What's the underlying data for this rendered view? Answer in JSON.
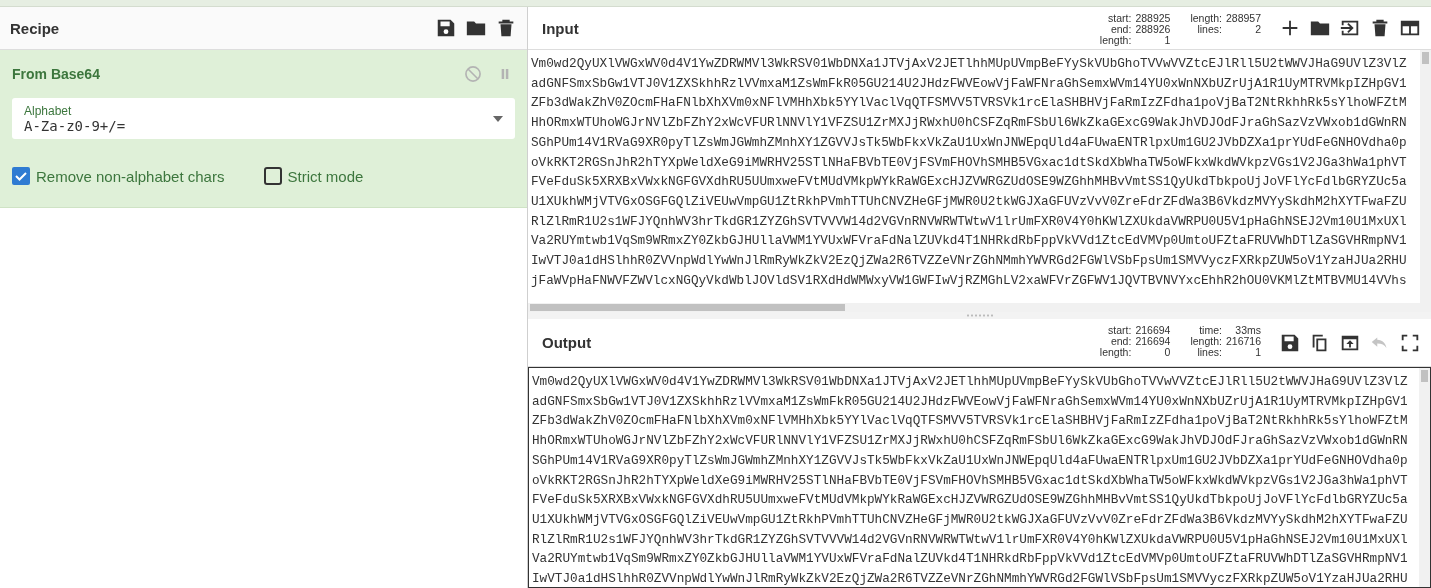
{
  "recipe": {
    "title": "Recipe",
    "operations": [
      {
        "name": "From Base64",
        "fields": [
          {
            "kind": "dropdown",
            "label": "Alphabet",
            "value": "A-Za-z0-9+/="
          }
        ],
        "checkboxes": [
          {
            "label": "Remove non-alphabet chars",
            "checked": true
          },
          {
            "label": "Strict mode",
            "checked": false
          }
        ]
      }
    ]
  },
  "input": {
    "title": "Input",
    "stats": [
      [
        {
          "label": "start:",
          "value": "288925"
        },
        {
          "label": "end:",
          "value": "288926"
        },
        {
          "label": "length:",
          "value": "1"
        }
      ],
      [
        {
          "label": "length:",
          "value": "288957"
        },
        {
          "label": "lines:",
          "value": "2"
        }
      ]
    ],
    "lines": [
      "Vm0wd2QyUXlVWGxWV0d4V1YwZDRWMVl3WkRSV01WbDNXa1JTVjAxV2JETlhhMUpUVmpBeFYySkVUbGhoTVVwVVZtcEJlRll5U2tWWVJHaG9UVlZ3VlZ",
      "adGNFSmxSbGw1VTJ0V1ZXSkhhRzlVVmxaM1ZsWmFkR05GU214U2JHdzFWVEowVjFaWFNraGhSemxWVm14YU0xWnNXbUZrUjA1R1UyMTRVMkpIZHpGV1",
      "ZFb3dWakZhV0ZOcmFHaFNlbXhXVm0xNFlVMHhXbk5YYlVaclVqQTFSMVV5TVRSVk1rcElaSHBHVjFaRmIzZFdha1poVjBaT2NtRkhhRk5sYlhoWFZtM",
      "HhORmxWTUhoWGJrNVlZbFZhY2xWcVFURlNNVlY1VFZSU1ZrMXJjRWxhU0hCSFZqRmFSbUl6WkZkaGExcG9WakJhVDJOdFJraGhSazVzVWxob1dGWnRN",
      "SGhPUm14V1RVaG9XR0pyTlZsWmJGWmhZMnhXY1ZGVVJsTk5WbFkxVkZaU1UxWnJNWEpqUld4aFUwaENTRlpxUm1GU2JVbDZXa1prYUdFeGNHOVdha0p",
      "oVkRKT2RGSnJhR2hTYXpWeldXeG9iMWRHV25STlNHaFBVbTE0VjFSVmFHOVhSMHB5VGxac1dtSkdXbWhaTW5oWFkxWkdWVkpzVGs1V2JGa3hWa1phVT",
      "FVeFduSk5XRXBxVWxkNGFGVXdhRU5UUmxweFVtMUdVMkpWYkRaWGExcHJZVWRGZUdOSE9WZGhhMHBvVmtSS1QyUkdTbkpoUjJoVFlYcFdlbGRYZUc5a",
      "U1XUkhWMjVTVGxOSGFGQlZiVEUwVmpGU1ZtRkhPVmhTTUhCNVZHeGFjMWR0U2tkWGJXaGFUVzVvV0ZreFdrZFdWa3B6VkdzMVYySkdhM2hXYTFwaFZU",
      "RlZlRmR1U2s1WFJYQnhWV3hrTkdGR1ZYZGhSVTVVVW14d2VGVnRNVWRWTWtwV1lrUmFXR0V4Y0hKWlZXUkdaVWRPU0U5V1pHaGhNSEJ2Vm10U1MxUXl",
      "Va2RUYmtwb1VqSm9WRmxZY0ZkbGJHUllaVWM1YVUxWFVraFdNalZUVkd4T1NHRkdRbFppVkVVd1ZtcEdVMVp0UmtoUFZtaFRUVWhDTlZaSGVHRmpNV1",
      "IwVTJ0a1dHSlhhR0ZVVnpWdlYwWnJlRmRyWkZkV2EzQjZWa2R6TVZZeVNrZGhNMmhYWVRGd2FGWlVSbFpsUm1SMVVyczFXRkpZUW5oV1YzaHJUa2RHU",
      "jFaWVpHaFNWVFZWVlcxNGQyVkdWblJOVldSV1RXdHdWMWxyVW1GWFIwVjRZMGhLV2xaWFVrZGFWV1JQVTBVNVYxcEhhR2hOU0VKMlZtMTBVMU14VVhs"
    ]
  },
  "output": {
    "title": "Output",
    "stats": [
      [
        {
          "label": "start:",
          "value": "216694"
        },
        {
          "label": "end:",
          "value": "216694"
        },
        {
          "label": "length:",
          "value": "0"
        }
      ],
      [
        {
          "label": "time:",
          "value": "33ms"
        },
        {
          "label": "length:",
          "value": "216716"
        },
        {
          "label": "lines:",
          "value": "1"
        }
      ]
    ],
    "lines": [
      "Vm0wd2QyUXlVWGxWV0d4V1YwZDRWMVl3WkRSV01WbDNXa1JTVjAxV2JETlhhMUpUVmpBeFYySkVUbGhoTVVwVVZtcEJlRll5U2tWWVJHaG9UVlZ3VlZ",
      "adGNFSmxSbGw1VTJ0V1ZXSkhhRzlVVmxaM1ZsWmFkR05GU214U2JHdzFWVEowVjFaWFNraGhSemxWVm14YU0xWnNXbUZrUjA1R1UyMTRVMkpIZHpGV1",
      "ZFb3dWakZhV0ZOcmFHaFNlbXhXVm0xNFlVMHhXbk5YYlVaclVqQTFSMVV5TVRSVk1rcElaSHBHVjFaRmIzZFdha1poVjBaT2NtRkhhRk5sYlhoWFZtM",
      "HhORmxWTUhoWGJrNVlZbFZhY2xWcVFURlNNVlY1VFZSU1ZrMXJjRWxhU0hCSFZqRmFSbUl6WkZkaGExcG9WakJhVDJOdFJraGhSazVzVWxob1dGWnRN",
      "SGhPUm14V1RVaG9XR0pyTlZsWmJGWmhZMnhXY1ZGVVJsTk5WbFkxVkZaU1UxWnJNWEpqUld4aFUwaENTRlpxUm1GU2JVbDZXa1prYUdFeGNHOVdha0p",
      "oVkRKT2RGSnJhR2hTYXpWeldXeG9iMWRHV25STlNHaFBVbTE0VjFSVmFHOVhSMHB5VGxac1dtSkdXbWhaTW5oWFkxWkdWVkpzVGs1V2JGa3hWa1phVT",
      "FVeFduSk5XRXBxVWxkNGFGVXdhRU5UUmxweFVtMUdVMkpWYkRaWGExcHJZVWRGZUdOSE9WZGhhMHBvVmtSS1QyUkdTbkpoUjJoVFlYcFdlbGRYZUc5a",
      "U1XUkhWMjVTVGxOSGFGQlZiVEUwVmpGU1ZtRkhPVmhTTUhCNVZHeGFjMWR0U2tkWGJXaGFUVzVvV0ZreFdrZFdWa3B6VkdzMVYySkdhM2hXYTFwaFZU",
      "RlZlRmR1U2s1WFJYQnhWV3hrTkdGR1ZYZGhSVTVVVW14d2VGVnRNVWRWTWtwV1lrUmFXR0V4Y0hKWlZXUkdaVWRPU0U5V1pHaGhNSEJ2Vm10U1MxUXl",
      "Va2RUYmtwb1VqSm9WRmxZY0ZkbGJHUllaVWM1YVUxWFVraFdNalZUVkd4T1NHRkdRbFppVkVVd1ZtcEdVMVp0UmtoUFZtaFRUVWhDTlZaSGVHRmpNV1",
      "IwVTJ0a1dHSlhhR0ZVVnpWdlYwWnJlRmRyWkZkV2EzQjZWa2R6TVZZeVNrZGhNMmhYWVRGd2FGWlVSbFpsUm1SMVVyczFXRkpZUW5oV1YzaHJUa2RHU"
    ]
  }
}
